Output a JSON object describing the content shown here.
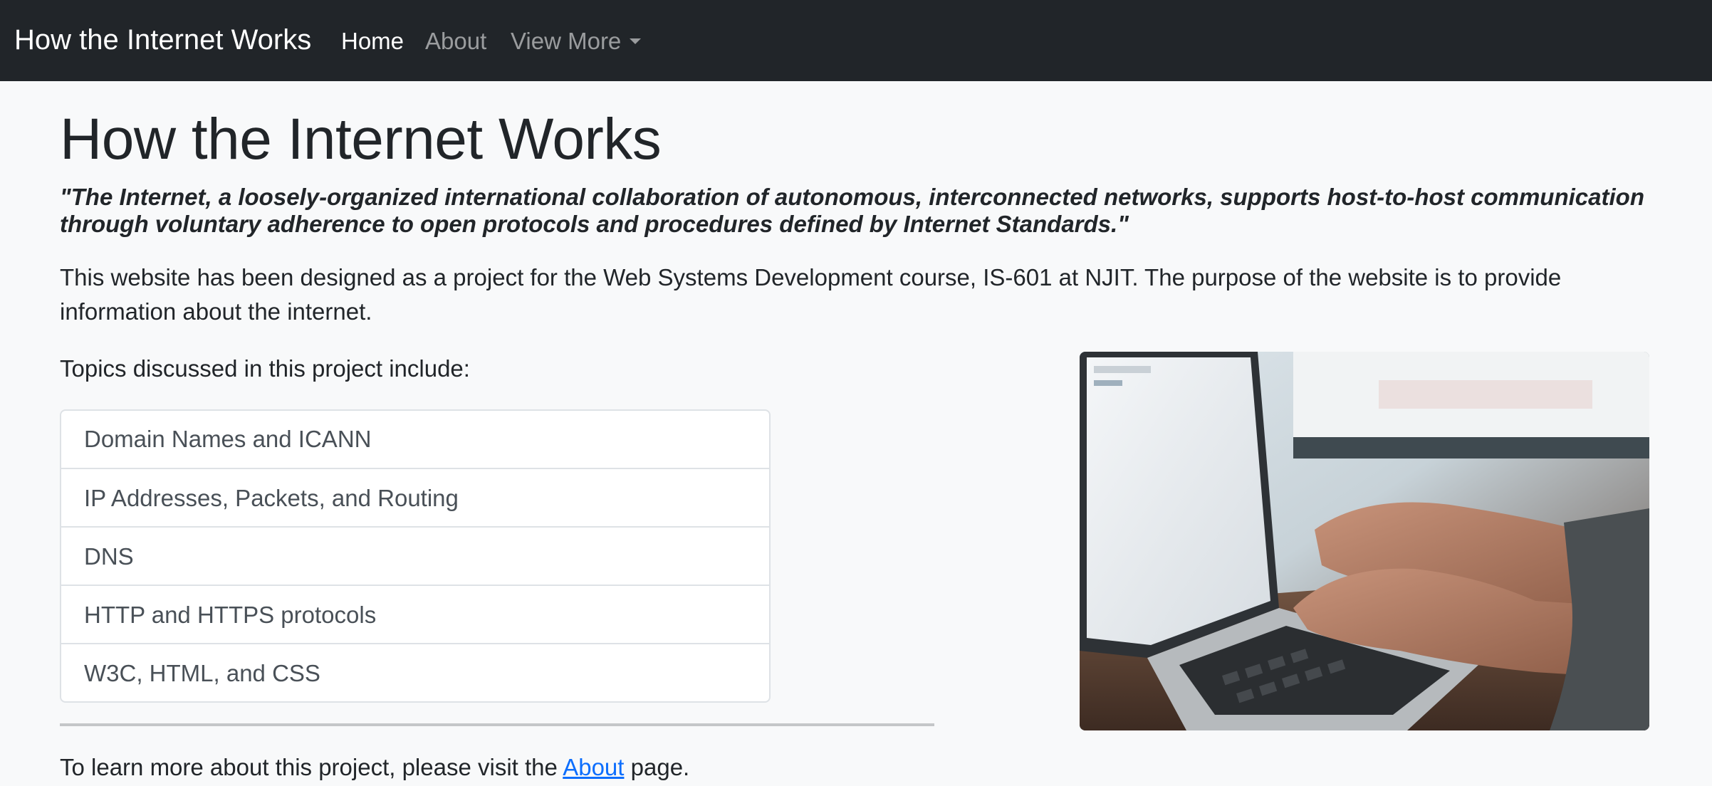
{
  "navbar": {
    "brand": "How the Internet Works",
    "links": [
      {
        "label": "Home",
        "active": true
      },
      {
        "label": "About",
        "active": false
      },
      {
        "label": "View More",
        "active": false,
        "dropdown": true
      }
    ]
  },
  "main": {
    "title": "How the Internet Works",
    "quote": "\"The Internet, a loosely-organized international collaboration of autonomous, interconnected networks, supports host-to-host communication through voluntary adherence to open protocols and procedures defined by Internet Standards.\"",
    "intro": "This website has been designed as a project for the Web Systems Development course, IS-601 at NJIT. The purpose of the website is to provide information about the internet.",
    "topics_heading": "Topics discussed in this project include:",
    "topics": [
      "Domain Names and ICANN",
      "IP Addresses, Packets, and Routing",
      "DNS",
      "HTTP and HTTPS protocols",
      "W3C, HTML, and CSS"
    ],
    "footer": {
      "before": "To learn more about this project, please visit the ",
      "link": "About",
      "after": " page."
    },
    "image": {
      "subject": "hands typing on a laptop keyboard"
    }
  },
  "colors": {
    "navbar_bg": "#212529",
    "page_bg": "#f8f9fa",
    "link": "#0d6efd"
  }
}
